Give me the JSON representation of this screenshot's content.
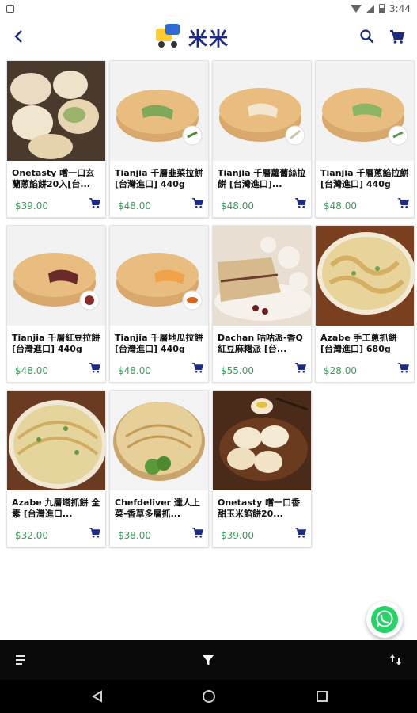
{
  "status_bar": {
    "time": "3:44"
  },
  "header": {
    "title": "米米",
    "logo_name": "brand-logo"
  },
  "products": [
    {
      "name": "Onetasty 嚐一口玄蘭蔥餡餅20入[台...",
      "price": "$39.00"
    },
    {
      "name": "Tianjia 千層韭菜拉餅 [台灣進口] 440g",
      "price": "$48.00"
    },
    {
      "name": "Tianjia 千層蘿蔔絲拉餅 [台灣進口]...",
      "price": "$48.00"
    },
    {
      "name": "Tianjia 千層蔥餡拉餅 [台灣進口] 440g",
      "price": "$48.00"
    },
    {
      "name": "Tianjia 千層紅豆拉餅 [台灣進口] 440g",
      "price": "$48.00"
    },
    {
      "name": "Tianjia 千層地瓜拉餅 [台灣進口] 440g",
      "price": "$48.00"
    },
    {
      "name": "Dachan 咕咕派-香Q紅豆麻糬派 [台...",
      "price": "$55.00"
    },
    {
      "name": "Azabe 手工蔥抓餅 [台灣進口] 680g",
      "price": "$28.00"
    },
    {
      "name": "Azabe 九層塔抓餅 全素 [台灣進口...",
      "price": "$32.00"
    },
    {
      "name": "Chefdeliver 達人上菜-香草多層抓...",
      "price": "$38.00"
    },
    {
      "name": "Onetasty 嚐一口香甜玉米餡餅20...",
      "price": "$39.00"
    }
  ],
  "colors": {
    "accent": "#1e2b84",
    "price": "#3a9e5d",
    "whatsapp": "#25d366"
  }
}
